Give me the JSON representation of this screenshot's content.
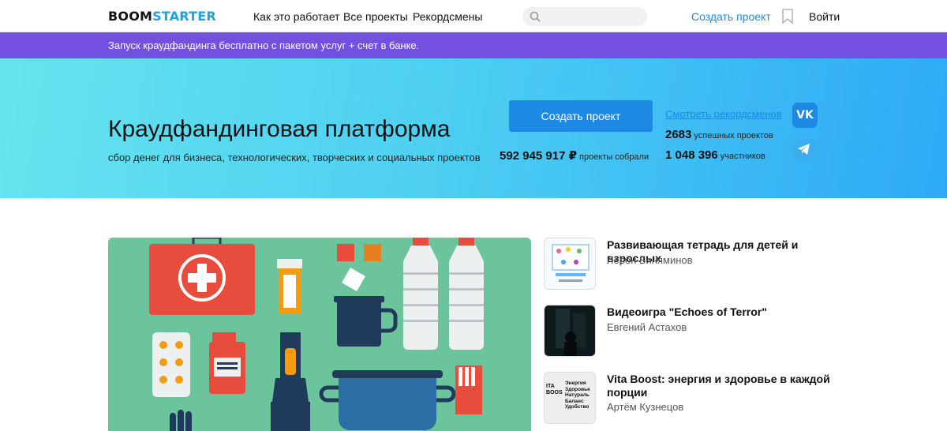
{
  "header": {
    "logo_a": "BOOM",
    "logo_b": "STARTER",
    "nav": [
      "Как это работает",
      "Все проекты",
      "Рекордсмены"
    ],
    "search_placeholder": "",
    "create_project": "Создать проект",
    "login": "Войти"
  },
  "promo": {
    "text": "Запуск краудфандинга бесплатно с пакетом услуг + счет в банке."
  },
  "hero": {
    "title": "Краудфандинговая платформа",
    "subtitle": "сбор денег для бизнеса, технологических, творческих и социальных проектов",
    "button": "Создать проект",
    "money_value": "592 945 917 ₽",
    "money_label": "проекты собрали",
    "records_link": "Смотреть рекордсменов",
    "success_value": "2683",
    "success_label": "успешных проектов",
    "participants_value": "1 048 396",
    "participants_label": "участников",
    "vk_label": "VK"
  },
  "projects": [
    {
      "title": "Развивающая тетрадь для детей и взрослых",
      "author": "Лерон Биняминов"
    },
    {
      "title": "Видеоигра \"Echoes of Terror\"",
      "author": "Евгений Астахов"
    },
    {
      "title": "Vita Boost: энергия и здоровье в каждой порции",
      "author": "Артём Кузнецов"
    }
  ],
  "thumb3_text": [
    "Энергия",
    "Здоровье",
    "Натураль",
    "Баланс",
    "Удобство"
  ],
  "thumb3_side": "ITA\nBOOS",
  "colors": {
    "accent": "#1e88e5",
    "promo": "#7450e0",
    "hero_start": "#66e4ee",
    "hero_end": "#2ea9f6",
    "banner_bg": "#6cc49c"
  }
}
